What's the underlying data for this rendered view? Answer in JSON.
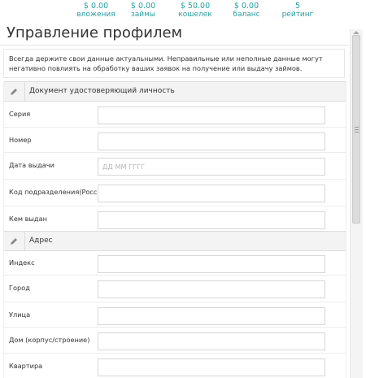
{
  "stats": [
    {
      "value": "$ 0.00",
      "label": "вложения"
    },
    {
      "value": "$ 0.00",
      "label": "займы"
    },
    {
      "value": "$ 50.00",
      "label": "кошелек"
    },
    {
      "value": "$ 0.00",
      "label": "баланс"
    },
    {
      "value": "5",
      "label": "рейтинг"
    }
  ],
  "page_title": "Управление профилем",
  "notice": "Всегда держите свои данные актуальными. Неправильные или неполные данные могут негативно повлиять на обработку ваших заявок на получение или выдачу займов.",
  "sections": {
    "document": {
      "title": "Документ удостоверяющий личность",
      "icon": "pencil-icon",
      "fields": [
        {
          "label": "Серия",
          "value": "",
          "placeholder": ""
        },
        {
          "label": "Номер",
          "value": "",
          "placeholder": ""
        },
        {
          "label": "Дата выдачи",
          "value": "",
          "placeholder": "ДД ММ ГГГГ"
        },
        {
          "label": "Код подразделения(Россия)",
          "value": "",
          "placeholder": ""
        },
        {
          "label": "Кем выдан",
          "value": "",
          "placeholder": ""
        }
      ]
    },
    "address": {
      "title": "Адрес",
      "icon": "pencil-icon",
      "fields": [
        {
          "label": "Индекс",
          "value": "",
          "placeholder": ""
        },
        {
          "label": "Город",
          "value": "",
          "placeholder": ""
        },
        {
          "label": "Улица",
          "value": "",
          "placeholder": ""
        },
        {
          "label": "Дом (корпус/строение)",
          "value": "",
          "placeholder": ""
        },
        {
          "label": "Квартира",
          "value": "",
          "placeholder": ""
        }
      ]
    }
  },
  "colors": {
    "accent": "#2a9d9e",
    "section_bg": "#f3f3f3",
    "border": "#d6d6d6"
  }
}
